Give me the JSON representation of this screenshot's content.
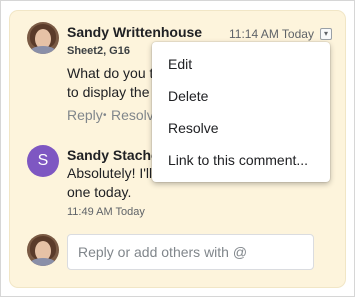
{
  "comment1": {
    "author": "Sandy Writtenhouse",
    "time": "11:14 AM Today",
    "cell_ref": "Sheet2, G16",
    "text_line1": "What do you t",
    "text_line2": "to display the",
    "reply_label": "Reply",
    "separator": "•",
    "resolve_label": "Resolve",
    "menu_button_glyph": "▾"
  },
  "menu": {
    "items": [
      "Edit",
      "Delete",
      "Resolve",
      "Link to this comment..."
    ]
  },
  "comment2": {
    "author": "Sandy Stache",
    "avatar_initial": "S",
    "avatar_color": "#7e57c2",
    "text_line1": "Absolutely! I'll",
    "text_line2": "one today.",
    "time": "11:49 AM Today"
  },
  "reply_box": {
    "placeholder": "Reply or add others with @"
  },
  "colors": {
    "card_background": "#fdf4dc"
  }
}
